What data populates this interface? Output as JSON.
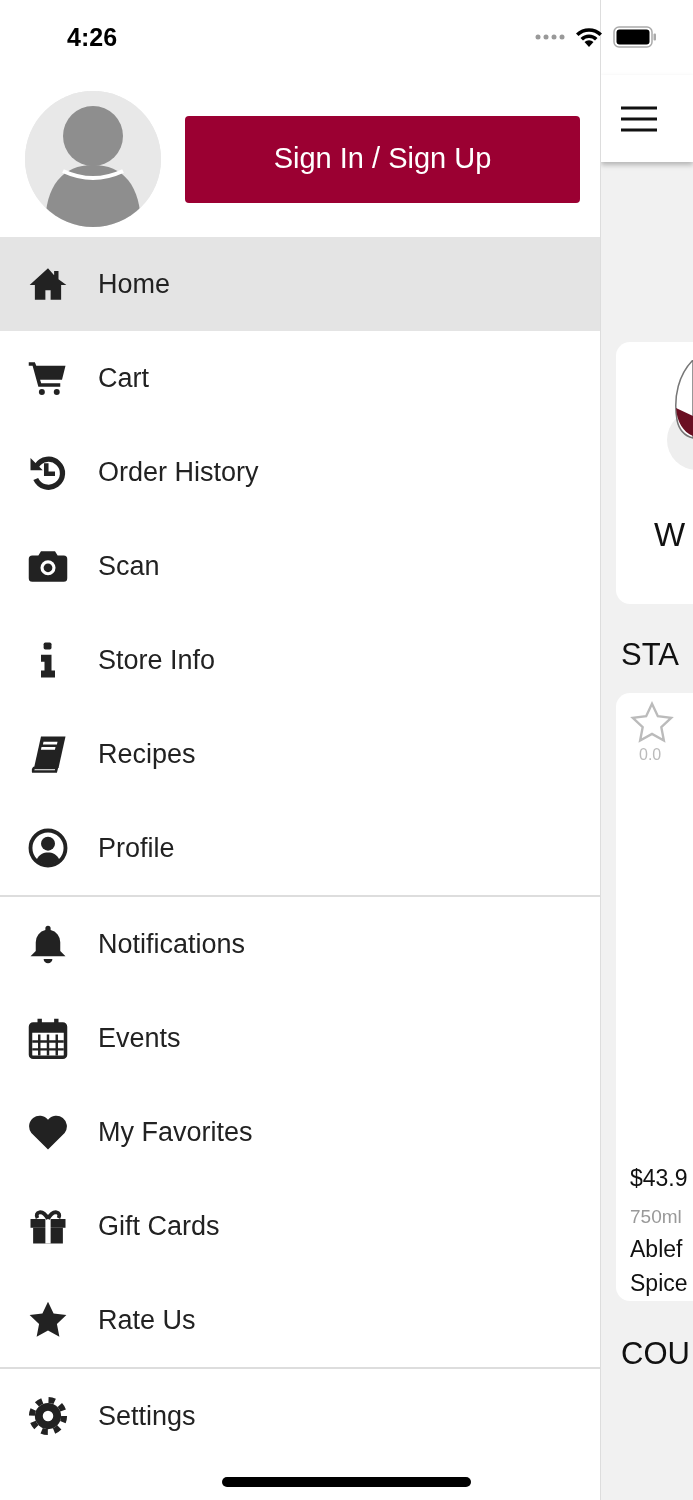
{
  "status_bar": {
    "time": "4:26"
  },
  "drawer": {
    "sign_in_button": "Sign In / Sign Up",
    "groups": [
      [
        {
          "kind": "home",
          "label": "Home",
          "selected": true
        },
        {
          "kind": "cart",
          "label": "Cart",
          "selected": false
        },
        {
          "kind": "history",
          "label": "Order History",
          "selected": false
        },
        {
          "kind": "camera",
          "label": "Scan",
          "selected": false
        },
        {
          "kind": "info",
          "label": "Store Info",
          "selected": false
        },
        {
          "kind": "book",
          "label": "Recipes",
          "selected": false
        },
        {
          "kind": "profile",
          "label": "Profile",
          "selected": false
        }
      ],
      [
        {
          "kind": "bell",
          "label": "Notifications",
          "selected": false
        },
        {
          "kind": "calendar",
          "label": "Events",
          "selected": false
        },
        {
          "kind": "heart",
          "label": "My Favorites",
          "selected": false
        },
        {
          "kind": "gift",
          "label": "Gift Cards",
          "selected": false
        },
        {
          "kind": "star",
          "label": "Rate Us",
          "selected": false
        }
      ],
      [
        {
          "kind": "gear",
          "label": "Settings",
          "selected": false
        }
      ]
    ]
  },
  "background_page": {
    "category_card": {
      "title": "W"
    },
    "section_1_title": "STA",
    "product": {
      "rating": "0.0",
      "price": "$43.9",
      "size": "750ml",
      "name_line_1": "Ablef",
      "name_line_2": "Spice"
    },
    "section_2_title": "COU"
  }
}
